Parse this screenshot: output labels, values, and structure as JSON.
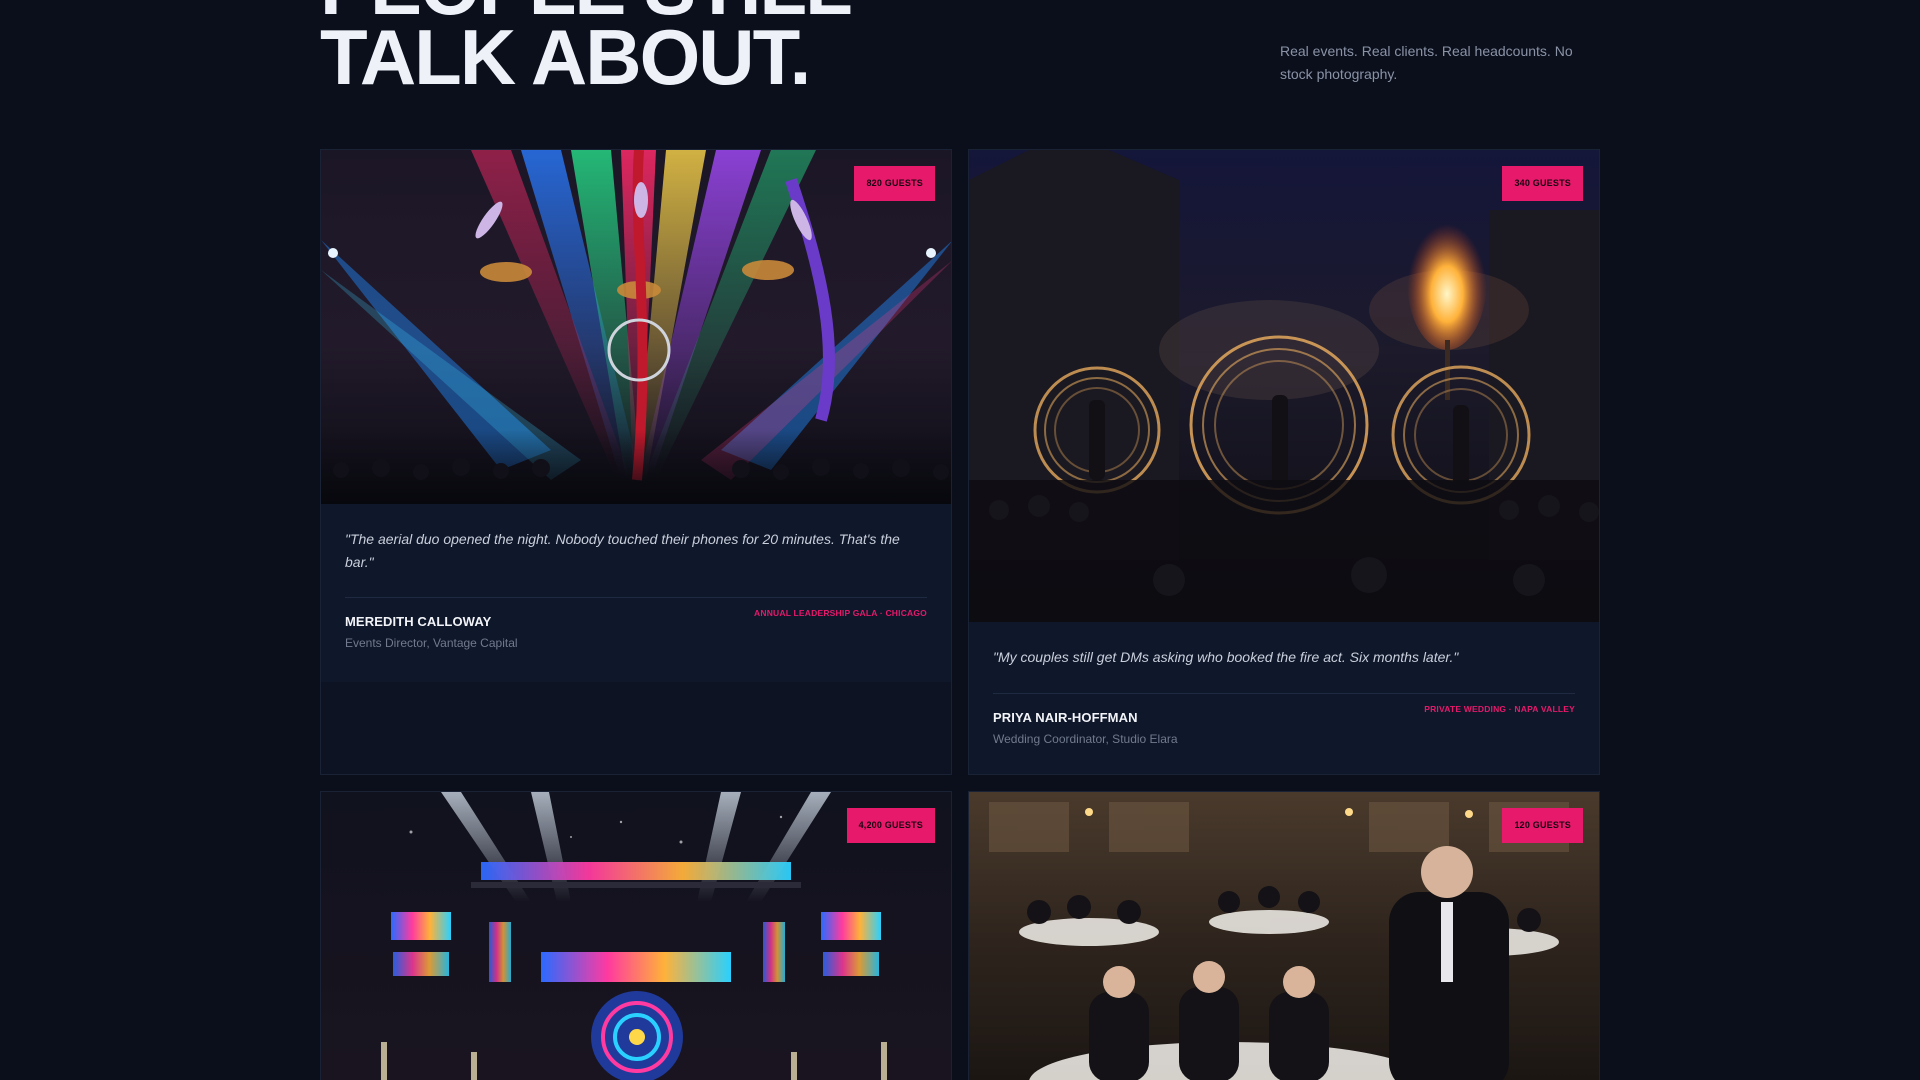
{
  "header": {
    "title_line1": "PEOPLE STILL",
    "title_line2": "TALK ABOUT.",
    "subtitle": "Real events. Real clients. Real headcounts. No stock photography."
  },
  "cards": [
    {
      "badge": "820 GUESTS",
      "photo": "aerial-circus-gala-photo",
      "quote": "\"The aerial duo opened the night. Nobody touched their phones for 20 minutes. That's the bar.\"",
      "person": "MEREDITH CALLOWAY",
      "role": "Events Director, Vantage Capital",
      "event": "ANNUAL LEADERSHIP GALA · CHICAGO"
    },
    {
      "badge": "340 GUESTS",
      "photo": "fire-performers-photo",
      "quote": "\"My couples still get DMs asking who booked the fire act. Six months later.\"",
      "person": "PRIYA NAIR-HOFFMAN",
      "role": "Wedding Coordinator, Studio Elara",
      "event": "PRIVATE WEDDING · NAPA VALLEY"
    },
    {
      "badge": "4,200 GUESTS",
      "photo": "concert-stage-photo"
    },
    {
      "badge": "120 GUESTS",
      "photo": "banquet-magician-photo"
    }
  ],
  "colors": {
    "background": "#0b0f1c",
    "accent": "#e6196b",
    "card": "#0d1322",
    "quote_box": "#0f172a"
  }
}
